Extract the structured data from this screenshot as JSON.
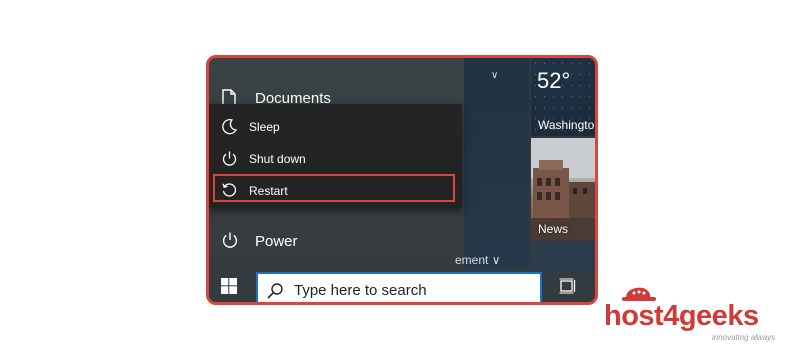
{
  "start_menu": {
    "documents_label": "Documents",
    "power_label": "Power",
    "more_label": "ement",
    "power_flyout": [
      {
        "label": "Sleep",
        "icon": "moon-icon"
      },
      {
        "label": "Shut down",
        "icon": "power-icon"
      },
      {
        "label": "Restart",
        "icon": "restart-icon",
        "highlighted": true
      }
    ]
  },
  "tiles": {
    "weather": {
      "temperature": "52°",
      "city": "Washingto"
    },
    "news": {
      "label": "News"
    }
  },
  "taskbar": {
    "search_placeholder": "Type here to search"
  },
  "brand": {
    "logo_text": "host4geeks",
    "tagline": "innovating always"
  },
  "colors": {
    "highlight_border": "#d9453f",
    "search_border": "#1a73c8",
    "flyout_bg": "#242424",
    "taskbar_bg": "#343b40",
    "logo_red": "#cf3b37"
  }
}
